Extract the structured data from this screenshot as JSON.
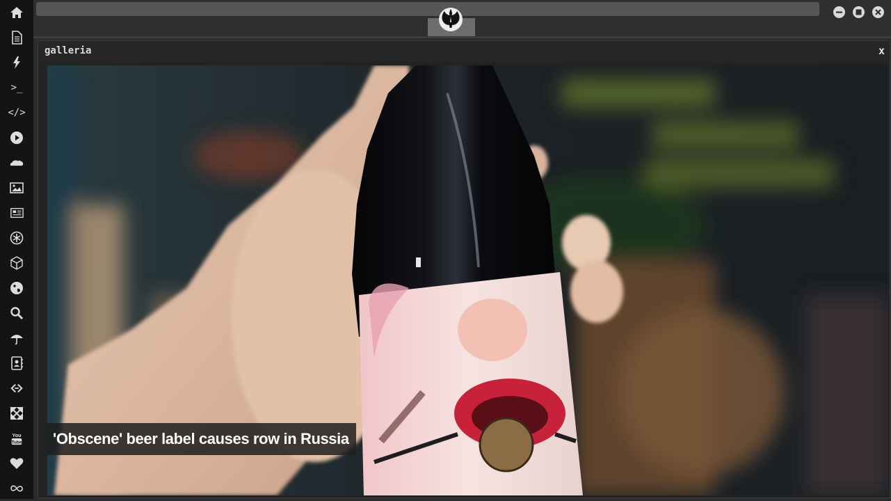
{
  "sidebar": {
    "items": [
      {
        "name": "home",
        "icon": "home-icon"
      },
      {
        "name": "document",
        "icon": "document-icon"
      },
      {
        "name": "lightning",
        "icon": "lightning-icon"
      },
      {
        "name": "terminal",
        "icon": "terminal-icon",
        "glyph": ">_"
      },
      {
        "name": "code",
        "icon": "code-icon",
        "glyph": "</>"
      },
      {
        "name": "play",
        "icon": "play-icon"
      },
      {
        "name": "soundcloud",
        "icon": "cloud-icon"
      },
      {
        "name": "image",
        "icon": "image-icon"
      },
      {
        "name": "newspaper",
        "icon": "newspaper-icon"
      },
      {
        "name": "atom",
        "icon": "atom-icon"
      },
      {
        "name": "cube",
        "icon": "cube-icon"
      },
      {
        "name": "globe",
        "icon": "globe-icon"
      },
      {
        "name": "search",
        "icon": "search-icon"
      },
      {
        "name": "umbrella",
        "icon": "umbrella-icon"
      },
      {
        "name": "contacts",
        "icon": "contact-book-icon"
      },
      {
        "name": "link",
        "icon": "link-icon"
      },
      {
        "name": "expand",
        "icon": "expand-icon"
      },
      {
        "name": "youtube",
        "icon": "youtube-icon",
        "glyph": "You Tube"
      },
      {
        "name": "heart",
        "icon": "heart-icon"
      },
      {
        "name": "infinity",
        "icon": "infinity-icon"
      }
    ]
  },
  "window": {
    "logo_icon": "rebel-alliance-logo-icon",
    "buttons": [
      "minimize-icon",
      "maximize-icon",
      "close-icon"
    ]
  },
  "gallery": {
    "title": "galleria",
    "close_label": "x",
    "caption": "'Obscene' beer label causes row in Russia"
  },
  "colors": {
    "sidebar_bg": "#141414",
    "panel_bg": "#232323",
    "icon": "#dcdcdc"
  }
}
